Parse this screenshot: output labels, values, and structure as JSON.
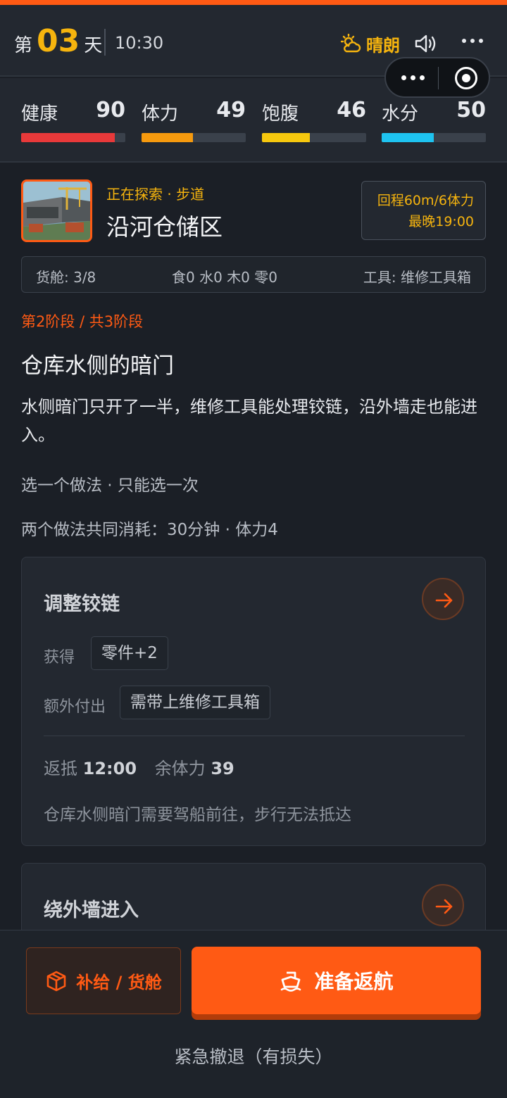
{
  "header": {
    "day_prefix": "第",
    "day_number": "03",
    "day_suffix": "天",
    "time": "10:30",
    "weather": "晴朗",
    "weather_icon": "partly-sunny-icon",
    "sound_icon": "speaker-icon"
  },
  "stats": [
    {
      "label": "健康",
      "value": "90",
      "level": 0.9,
      "color": "#e8393a"
    },
    {
      "label": "体力",
      "value": "49",
      "level": 0.49,
      "color": "#f69a0e"
    },
    {
      "label": "饱腹",
      "value": "46",
      "level": 0.46,
      "color": "#f6c80e"
    },
    {
      "label": "水分",
      "value": "50",
      "level": 0.5,
      "color": "#1ec3f0"
    }
  ],
  "location": {
    "status": "正在探索 · 步道",
    "name": "沿河仓储区",
    "return_cost": "回程60m/6体力",
    "latest": "最晚19:00"
  },
  "cargo": {
    "hold": "货舱: 3/8",
    "supplies": "食0 水0 木0 零0",
    "tool": "工具: 维修工具箱"
  },
  "event": {
    "stage": "第2阶段 / 共3阶段",
    "title": "仓库水侧的暗门",
    "description": "水侧暗门只开了一半，维修工具能处理铰链，沿外墙走也能进入。",
    "choose_hint": "选一个做法 · 只能选一次",
    "common_cost": "两个做法共同消耗：30分钟 · 体力4"
  },
  "options": [
    {
      "title": "调整铰链",
      "gain_label": "获得",
      "gain_value": "零件+2",
      "extra_label": "额外付出",
      "extra_value": "需带上维修工具箱",
      "return_label": "返抵",
      "return_time": "12:00",
      "stamina_label": "余体力",
      "stamina_value": "39",
      "note": "仓库水侧暗门需要驾船前往，步行无法抵达"
    },
    {
      "title": "绕外墙进入"
    }
  ],
  "bottom": {
    "supply_label": "补给 / 货舱",
    "return_label": "准备返航",
    "retreat_label": "紧急撤退（有损失）"
  },
  "colors": {
    "accent": "#ff5a14",
    "gold": "#f6b40e"
  }
}
